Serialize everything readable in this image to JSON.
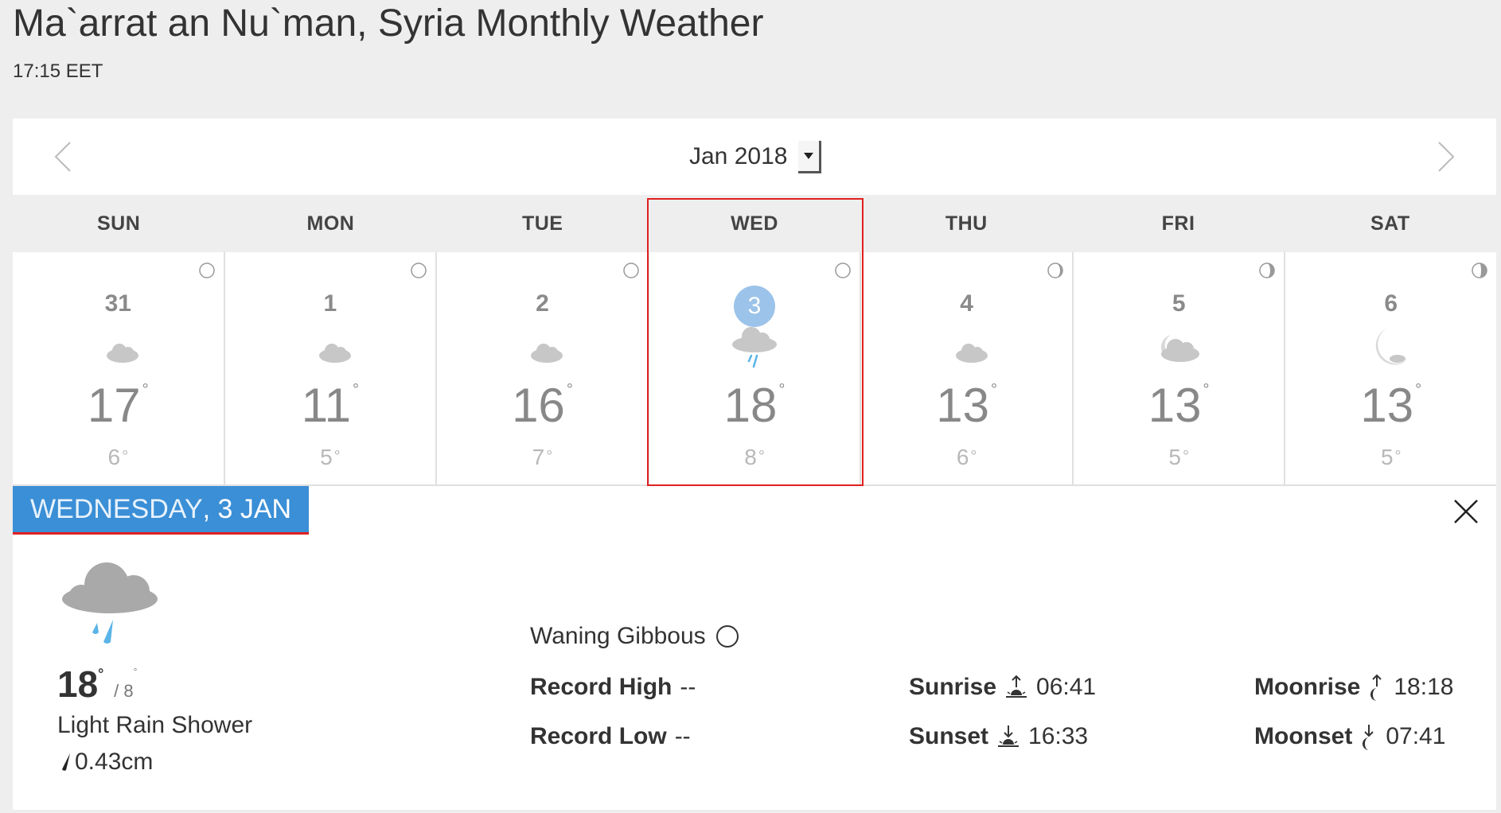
{
  "header": {
    "title": "Ma`arrat an Nu`man, Syria Monthly Weather",
    "time": "17:15 EET"
  },
  "calendar": {
    "month_label": "Jan 2018",
    "weekdays": [
      "SUN",
      "MON",
      "TUE",
      "WED",
      "THU",
      "FRI",
      "SAT"
    ],
    "days": [
      {
        "num": "31",
        "high": "17",
        "low": "6",
        "icon": "partly-cloudy-night-icon"
      },
      {
        "num": "1",
        "high": "11",
        "low": "5",
        "icon": "partly-cloudy-night-icon"
      },
      {
        "num": "2",
        "high": "16",
        "low": "7",
        "icon": "partly-cloudy-night-icon"
      },
      {
        "num": "3",
        "high": "18",
        "low": "8",
        "icon": "light-rain-icon",
        "today": true
      },
      {
        "num": "4",
        "high": "13",
        "low": "6",
        "icon": "partly-cloudy-night-icon"
      },
      {
        "num": "5",
        "high": "13",
        "low": "5",
        "icon": "mostly-cloudy-night-icon"
      },
      {
        "num": "6",
        "high": "13",
        "low": "5",
        "icon": "clear-night-icon"
      }
    ]
  },
  "detail": {
    "weekday": "WEDNESDAY",
    "date": ", 3 JAN",
    "high": "18",
    "low": "/ 8",
    "condition": "Light Rain Shower",
    "precip": "0.43cm",
    "moon_phase": "Waning Gibbous",
    "record_high_label": "Record High",
    "record_high_value": "--",
    "record_low_label": "Record Low",
    "record_low_value": "--",
    "sunrise_label": "Sunrise",
    "sunrise_value": "06:41",
    "sunset_label": "Sunset",
    "sunset_value": "16:33",
    "moonrise_label": "Moonrise",
    "moonrise_value": "18:18",
    "moonset_label": "Moonset",
    "moonset_value": "07:41"
  },
  "colors": {
    "accent": "#3a8fd6",
    "today_circle": "#9cc3ea",
    "highlight_outline": "#e02020",
    "rain": "#5ab4e8"
  }
}
